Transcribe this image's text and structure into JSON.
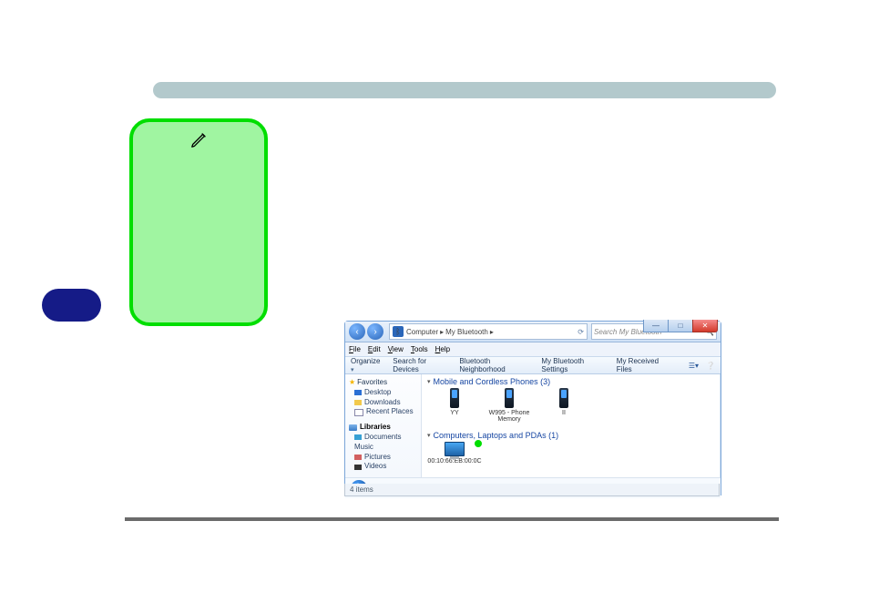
{
  "note": {
    "text": ""
  },
  "explorer": {
    "nav": {
      "back": "‹",
      "fwd": "›"
    },
    "breadcrumb": {
      "root": "Computer",
      "node": "My Bluetooth"
    },
    "search_placeholder": "Search My Bluetooth",
    "winbuttons": {
      "min": "—",
      "max": "□",
      "close": "✕"
    },
    "menu": {
      "file": "File",
      "edit": "Edit",
      "view": "View",
      "tools": "Tools",
      "help": "Help"
    },
    "cmd": {
      "organize": "Organize",
      "search_devices": "Search for Devices",
      "bt_neighborhood": "Bluetooth Neighborhood",
      "my_settings": "My Bluetooth Settings",
      "my_received": "My Received Files"
    },
    "tree": {
      "favorites": "Favorites",
      "desktop": "Desktop",
      "downloads": "Downloads",
      "recent": "Recent Places",
      "libraries": "Libraries",
      "documents": "Documents",
      "music": "Music",
      "pictures": "Pictures",
      "videos": "Videos"
    },
    "groups": [
      {
        "title": "Mobile and Cordless Phones (3)",
        "devices": [
          {
            "label": "YY"
          },
          {
            "label": "W995 - Phone Memory"
          },
          {
            "label": "II"
          }
        ]
      },
      {
        "title": "Computers, Laptops and PDAs (1)",
        "devices": [
          {
            "label": "00:10:66:EB:00:0C"
          }
        ]
      }
    ],
    "details": "4 items",
    "status": "4 items"
  }
}
